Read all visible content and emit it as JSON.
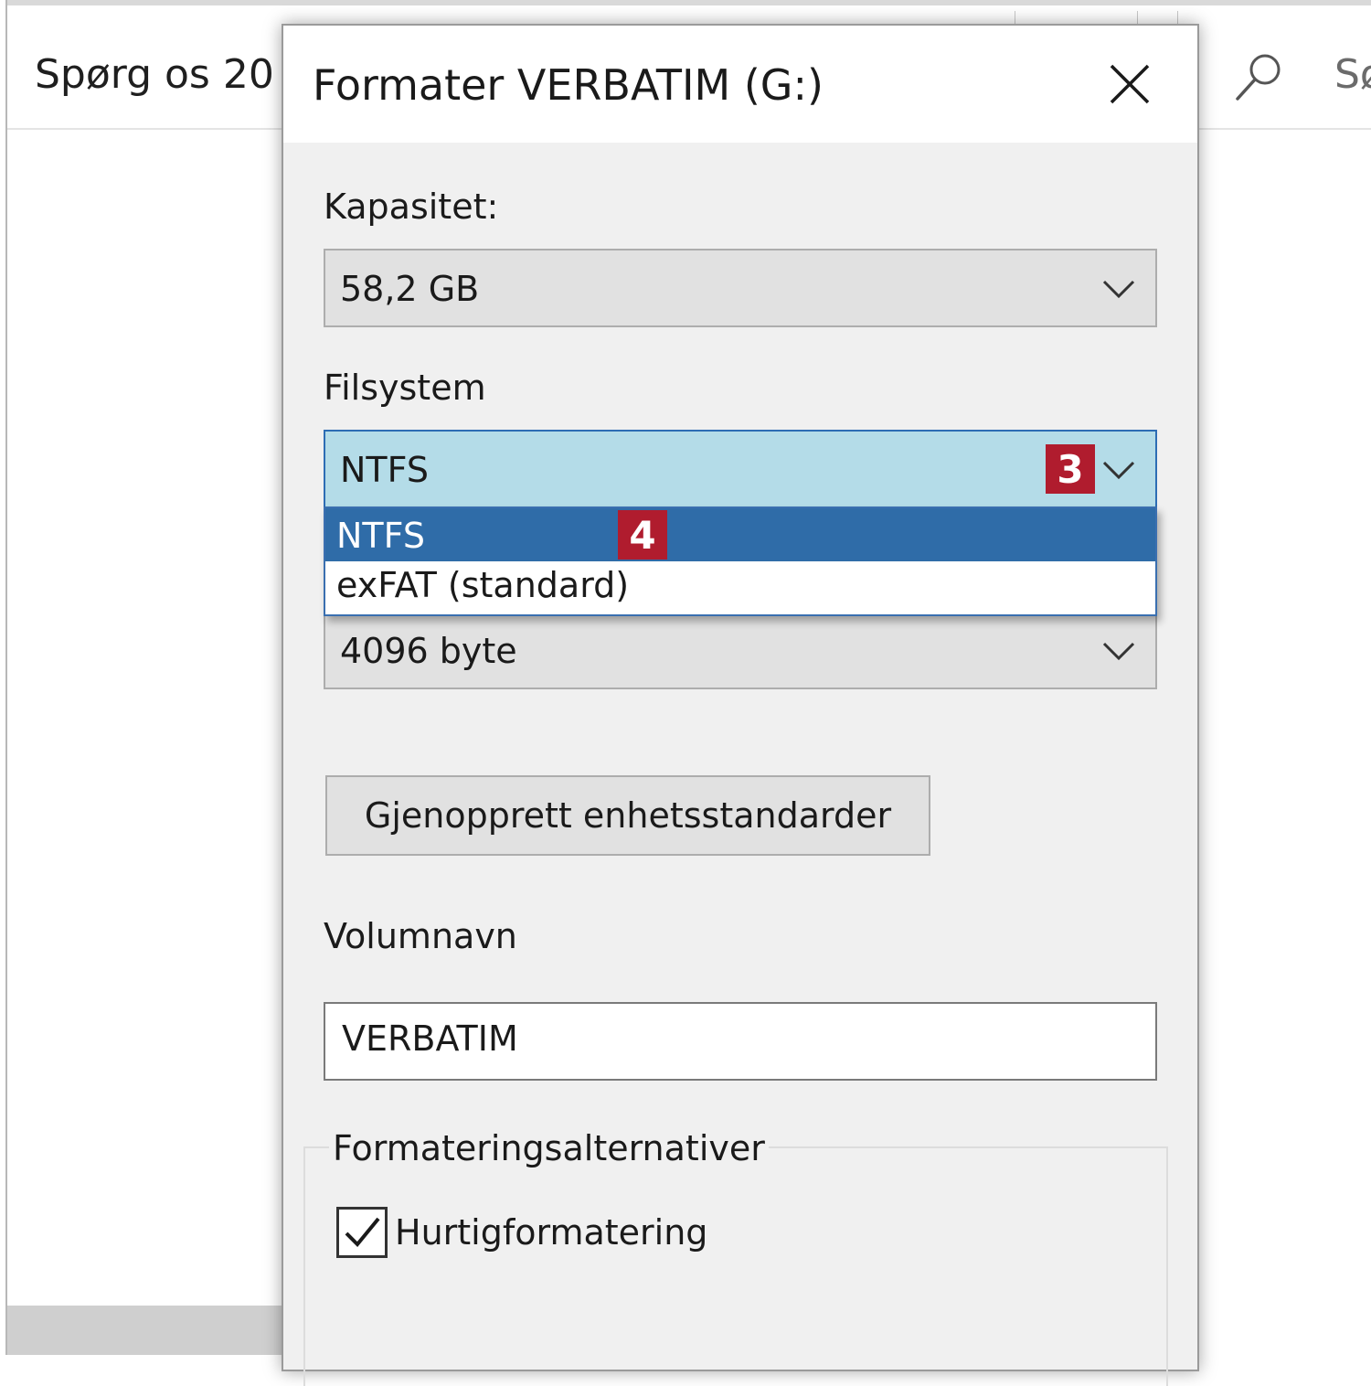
{
  "background_window": {
    "title": "Spørg os 20",
    "search_text": "Sø"
  },
  "dialog": {
    "title": "Formater VERBATIM (G:)",
    "capacity": {
      "label": "Kapasitet:",
      "value": "58,2 GB"
    },
    "filesystem": {
      "label": "Filsystem",
      "value": "NTFS",
      "badge": "3",
      "options": [
        {
          "label": "NTFS",
          "selected": true
        },
        {
          "label": "exFAT (standard)",
          "selected": false
        }
      ],
      "option_badge": "4"
    },
    "allocation": {
      "value": "4096 byte"
    },
    "restore_button": "Gjenopprett enhetsstandarder",
    "volume": {
      "label": "Volumnavn",
      "value": "VERBATIM"
    },
    "options_group": {
      "legend": "Formateringsalternativer",
      "quick_format": {
        "label": "Hurtigformatering",
        "checked": true
      }
    }
  },
  "colors": {
    "badge": "#b01c2e",
    "selected_option": "#2f6ca8",
    "focused_combo": "#b4dce8"
  }
}
